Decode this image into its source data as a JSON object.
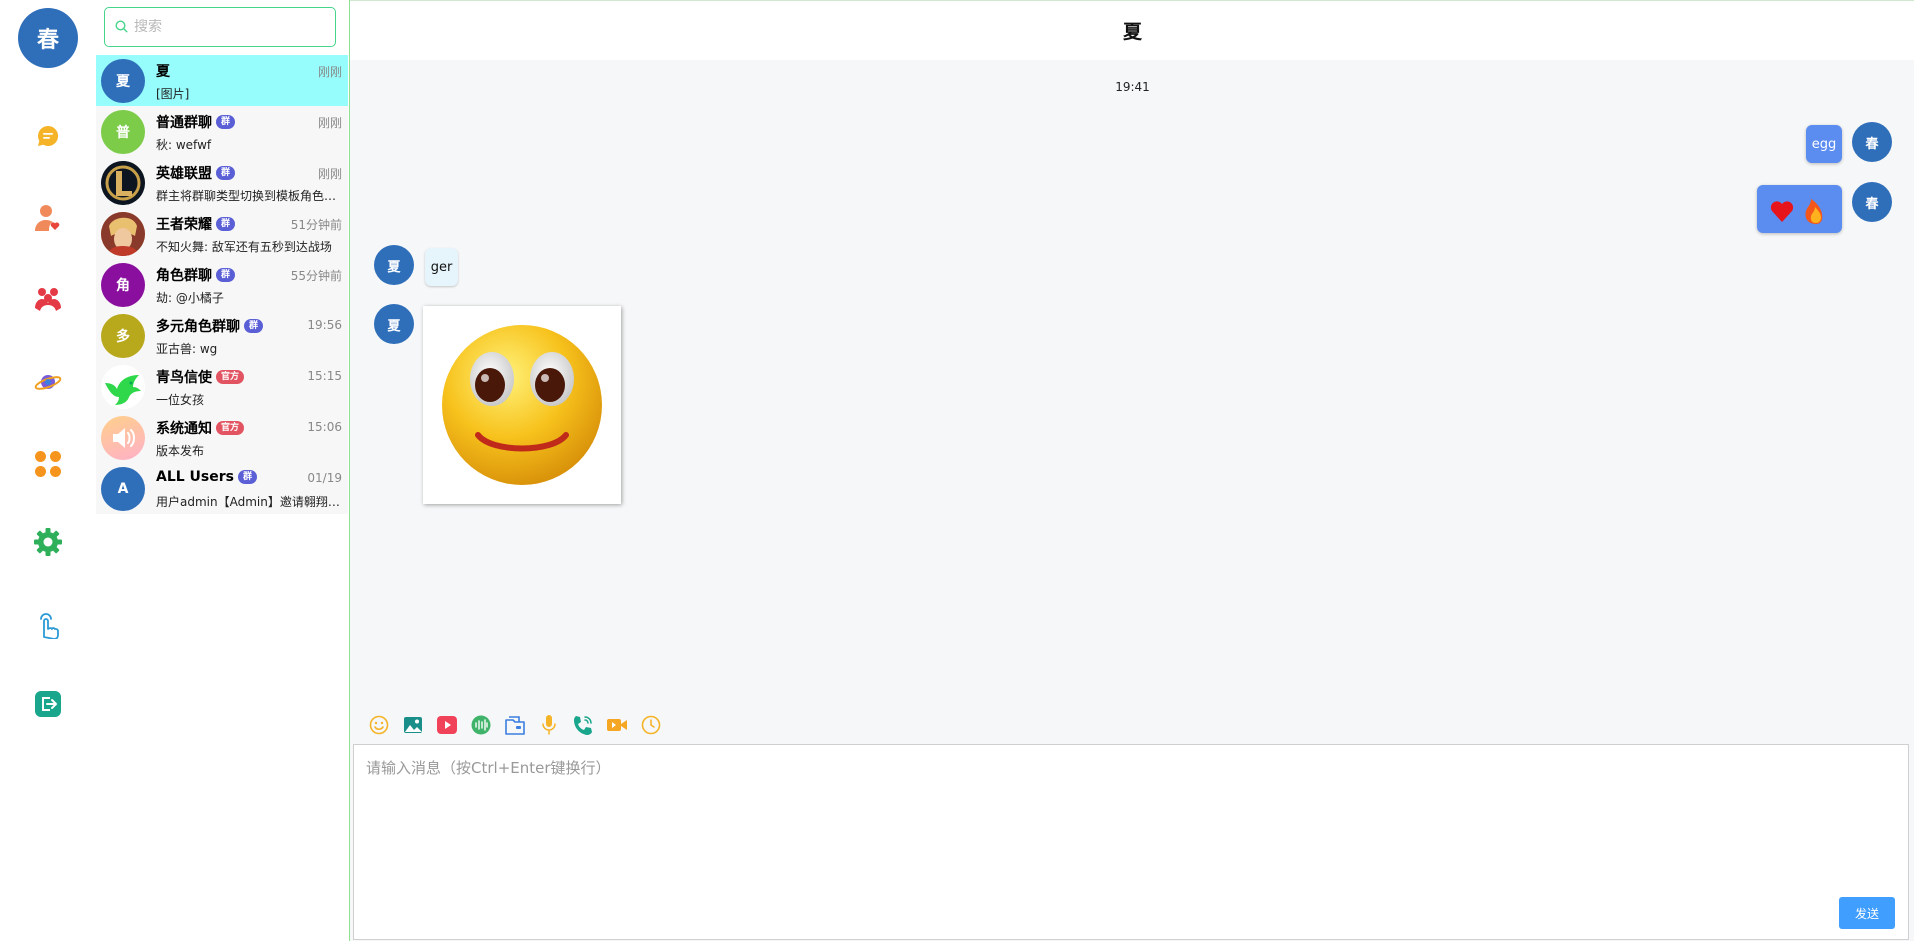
{
  "user": {
    "avatar_text": "春"
  },
  "nav": {
    "items": [
      {
        "icon": "chat-bubble-icon",
        "color": "#f5b428"
      },
      {
        "icon": "contacts-heart-icon",
        "color": "#f08a5b"
      },
      {
        "icon": "group-icon",
        "color": "#e43a45"
      },
      {
        "icon": "planet-icon",
        "color": "#3b7fe0"
      },
      {
        "icon": "apps-grid-icon",
        "color": "#f7941d"
      },
      {
        "icon": "settings-gear-icon",
        "color": "#2eaf5a"
      },
      {
        "icon": "tap-hand-icon",
        "color": "#2a9ad6"
      },
      {
        "icon": "logout-icon",
        "color": "#1aa68c"
      }
    ]
  },
  "search": {
    "placeholder": "搜索"
  },
  "conversations": [
    {
      "name": "夏",
      "avatar_text": "夏",
      "avatar_color": "#2f6fba",
      "badge": "",
      "time": "刚刚",
      "preview": "[图片]",
      "active": true
    },
    {
      "name": "普通群聊",
      "avatar_text": "普",
      "avatar_color": "#7ccc4a",
      "badge": "群",
      "time": "刚刚",
      "preview": "秋: wefwf"
    },
    {
      "name": "英雄联盟",
      "avatar_text": "",
      "avatar_color": "#1e2a3a",
      "badge": "群",
      "time": "刚刚",
      "preview": "群主将群聊类型切换到模板角色群聊"
    },
    {
      "name": "王者荣耀",
      "avatar_text": "",
      "avatar_color": "#c98a5a",
      "badge": "群",
      "time": "51分钟前",
      "preview": "不知火舞: 敌军还有五秒到达战场"
    },
    {
      "name": "角色群聊",
      "avatar_text": "角",
      "avatar_color": "#8a0f9e",
      "badge": "群",
      "time": "55分钟前",
      "preview": "劫: @小橘子"
    },
    {
      "name": "多元角色群聊",
      "avatar_text": "多",
      "avatar_color": "#b8a81c",
      "badge": "群",
      "time": "19:56",
      "preview": "亚古兽: wg"
    },
    {
      "name": "青鸟信使",
      "avatar_text": "",
      "avatar_color": "#ffffff",
      "badge": "官方",
      "time": "15:15",
      "preview": "一位女孩"
    },
    {
      "name": "系统通知",
      "avatar_text": "",
      "avatar_color": "#ffc58f",
      "badge": "官方",
      "time": "15:06",
      "preview": "版本发布"
    },
    {
      "name": "ALL Users",
      "avatar_text": "A",
      "avatar_color": "#2f6fba",
      "badge": "群",
      "time": "01/19",
      "preview": "用户admin【Admin】邀请翱翔加入群聊"
    }
  ],
  "chat": {
    "title": "夏",
    "timestamp": "19:41",
    "messages": [
      {
        "side": "out",
        "sender_avatar": "春",
        "text": "egg"
      },
      {
        "side": "out",
        "sender_avatar": "春",
        "emoji": "❤🔥"
      },
      {
        "side": "in",
        "sender_avatar": "夏",
        "text": "ger"
      },
      {
        "side": "in",
        "sender_avatar": "夏",
        "image": "smiley-face-image"
      }
    ]
  },
  "composer": {
    "tools": [
      "emoji-icon",
      "image-icon",
      "video-icon",
      "voice-wave-icon",
      "file-icon",
      "microphone-icon",
      "phone-call-icon",
      "video-call-icon",
      "history-clock-icon"
    ],
    "placeholder": "请输入消息（按Ctrl+Enter键换行）",
    "send_label": "发送"
  }
}
